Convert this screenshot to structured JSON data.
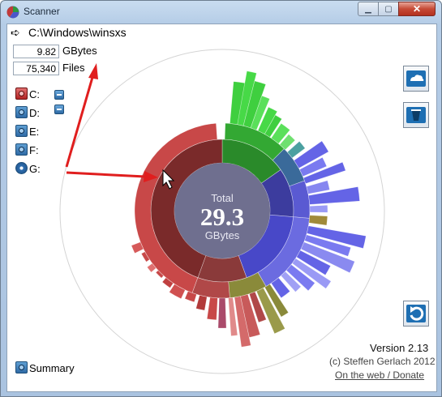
{
  "window": {
    "title": "Scanner"
  },
  "path": {
    "text": "C:\\Windows\\winsxs"
  },
  "stats": {
    "size_value": "9.82",
    "size_unit": "GBytes",
    "files_value": "75,340",
    "files_label": "Files"
  },
  "drives": [
    {
      "label": "C:",
      "kind": "hdd-red"
    },
    {
      "label": "D:",
      "kind": "hdd"
    },
    {
      "label": "E:",
      "kind": "hdd"
    },
    {
      "label": "F:",
      "kind": "hdd"
    },
    {
      "label": "G:",
      "kind": "cd"
    }
  ],
  "center": {
    "label": "Total",
    "value": "29.3",
    "unit": "GBytes"
  },
  "summary": {
    "label": "Summary"
  },
  "footer": {
    "version": "Version 2.13",
    "copyright": "(c) Steffen Gerlach 2012",
    "link": "On the web / Donate"
  },
  "colors": {
    "c_drive": "#c83c3c",
    "green": "#3fcf3f",
    "blue": "#6464e6",
    "center": "#6f6f8f",
    "arrow": "#e01e1e"
  }
}
